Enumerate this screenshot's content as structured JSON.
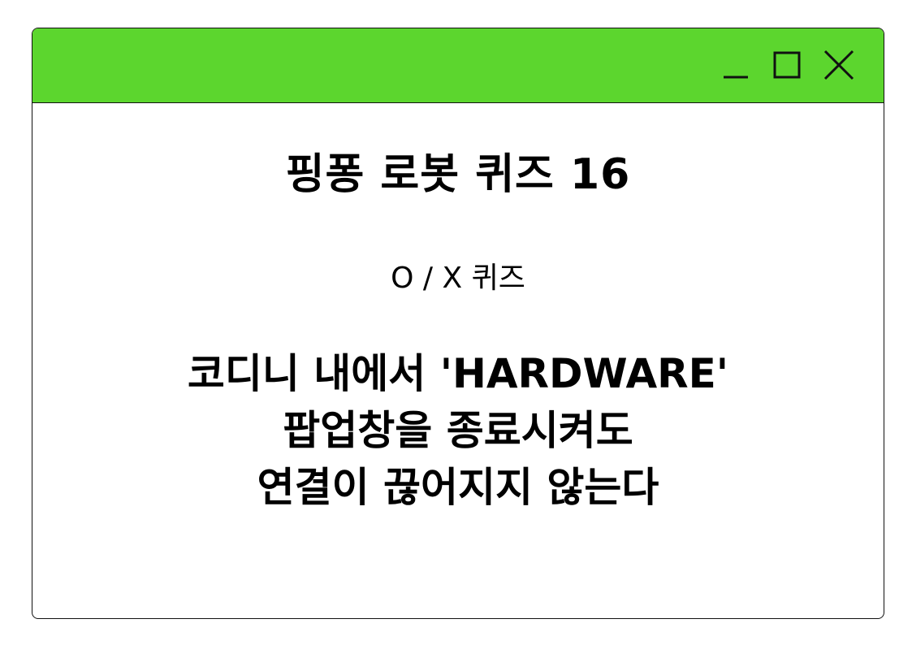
{
  "window": {
    "titlebar_color": "#5cd62e",
    "controls": [
      "minimize-icon",
      "maximize-icon",
      "close-icon"
    ]
  },
  "quiz": {
    "title": "핑퐁 로봇 퀴즈 16",
    "type_label": "O / X 퀴즈",
    "question_lines": [
      "코디니 내에서 'HARDWARE'",
      "팝업창을 종료시켜도",
      "연결이 끊어지지 않는다"
    ]
  }
}
